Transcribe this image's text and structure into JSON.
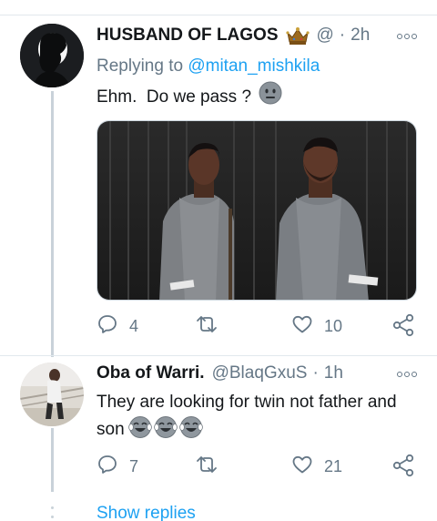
{
  "colors": {
    "link": "#1da1f2",
    "muted": "#657786",
    "text": "#14171a",
    "thread_line": "#c9d2d9"
  },
  "tweet1": {
    "display_name": "HUSBAND OF LAGOS",
    "badge_icon": "crown-emoji",
    "handle": "@",
    "separator": "·",
    "time": "2h",
    "replying_prefix": "Replying to",
    "replying_to": "@mitan_mishkila",
    "text": "Ehm.  Do we pass ?",
    "text_emoji": "neutral-face-emoji",
    "media_alt": "two men in grey native outfits standing in front of a dark wooden fence",
    "counts": {
      "replies": "4",
      "retweets": "",
      "likes": "10"
    }
  },
  "tweet2": {
    "display_name": "Oba of Warri.",
    "handle": "@BlaqGxuS",
    "separator": "·",
    "time": "1h",
    "text": "They are looking for twin not father and son",
    "text_emojis": [
      "tears-of-joy-emoji",
      "tears-of-joy-emoji",
      "tears-of-joy-emoji"
    ],
    "counts": {
      "replies": "7",
      "retweets": "",
      "likes": "21"
    }
  },
  "show_replies_label": "Show replies"
}
